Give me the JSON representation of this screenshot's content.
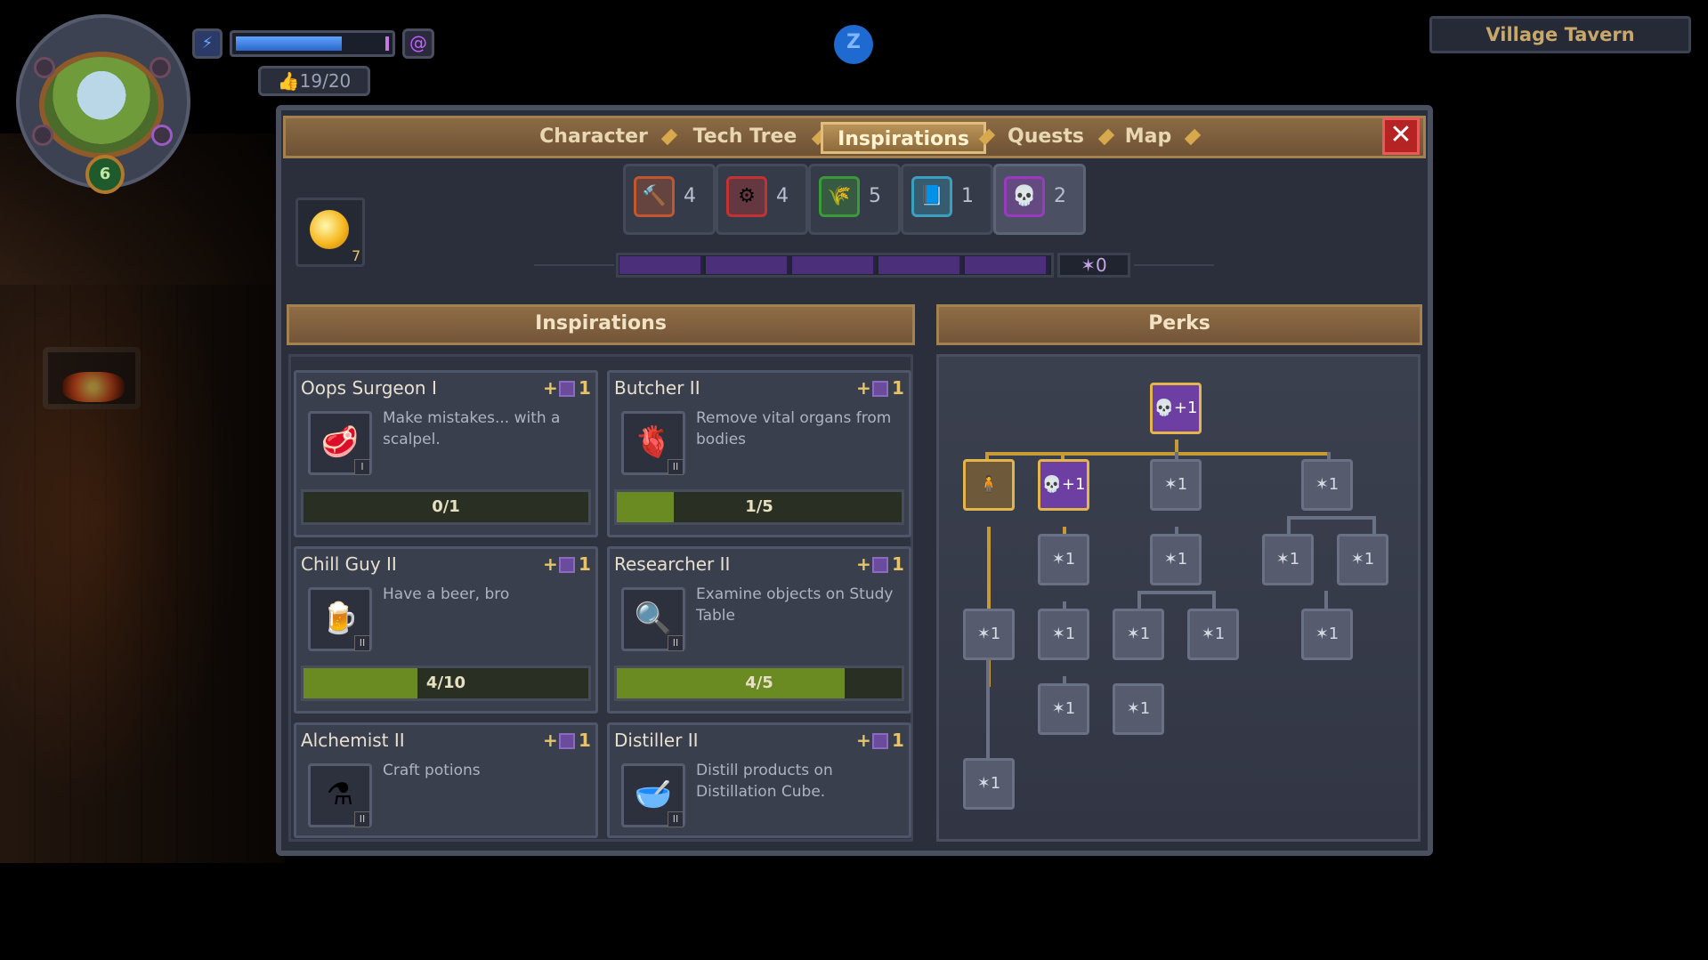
{
  "hud": {
    "level_badge": "6",
    "likes": "19/20",
    "energy_fill_fraction": 0.7,
    "sleep_icon": "Z",
    "location_name": "Village Tavern"
  },
  "tabs": [
    {
      "label": "Character",
      "active": false
    },
    {
      "label": "Tech Tree",
      "active": false
    },
    {
      "label": "Inspirations",
      "active": true
    },
    {
      "label": "Quests",
      "active": false
    },
    {
      "label": "Map",
      "active": false
    }
  ],
  "close_label": "✕",
  "inspiration_points": "7",
  "categories": [
    {
      "icon": "hammer-icon",
      "glyph": "🔨",
      "count": "4",
      "color": "#c2562f"
    },
    {
      "icon": "gear-icon",
      "glyph": "⚙",
      "count": "4",
      "color": "#c23232"
    },
    {
      "icon": "wheat-icon",
      "glyph": "🌾",
      "count": "5",
      "color": "#3a9a3a"
    },
    {
      "icon": "book-icon",
      "glyph": "📘",
      "count": "1",
      "color": "#3aa0c0"
    },
    {
      "icon": "skull-icon",
      "glyph": "💀",
      "count": "2",
      "color": "#9a3ac0"
    }
  ],
  "star_progress": {
    "value": "✶0",
    "segments_filled": 0,
    "segments_total": 5
  },
  "sections": {
    "inspirations": "Inspirations",
    "perks": "Perks"
  },
  "cards": [
    {
      "title": "Oops Surgeon I",
      "plus": "+",
      "cost": "1",
      "desc": "Make mistakes... with a scalpel.",
      "progress": "0/1",
      "fill": 0,
      "rank": "I",
      "icon": "meat-icon",
      "glyph": "🥩"
    },
    {
      "title": "Butcher II",
      "plus": "+",
      "cost": "1",
      "desc": "Remove vital organs from bodies",
      "progress": "1/5",
      "fill": 0.2,
      "rank": "II",
      "icon": "heart-organ-icon",
      "glyph": "🫀"
    },
    {
      "title": "Chill Guy II",
      "plus": "+",
      "cost": "1",
      "desc": "Have a beer, bro",
      "progress": "4/10",
      "fill": 0.4,
      "rank": "II",
      "icon": "beer-mug-icon",
      "glyph": "🍺"
    },
    {
      "title": "Researcher II",
      "plus": "+",
      "cost": "1",
      "desc": "Examine objects on Study Table",
      "progress": "4/5",
      "fill": 0.8,
      "rank": "II",
      "icon": "magnifier-icon",
      "glyph": "🔍"
    },
    {
      "title": "Alchemist II",
      "plus": "+",
      "cost": "1",
      "desc": "Craft potions",
      "progress": "",
      "fill": 0,
      "rank": "II",
      "icon": "potion-icon",
      "glyph": "⚗"
    },
    {
      "title": "Distiller II",
      "plus": "+",
      "cost": "1",
      "desc": "Distill products on Distillation Cube.",
      "progress": "",
      "fill": 0,
      "rank": "II",
      "icon": "distill-bowl-icon",
      "glyph": "🥣"
    }
  ],
  "perk_labels": {
    "plus_one": "+1",
    "lock_star": "✶1"
  }
}
